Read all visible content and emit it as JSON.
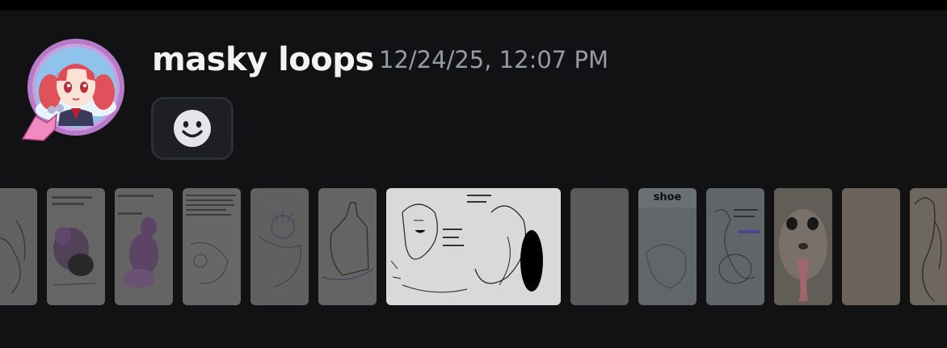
{
  "message": {
    "username": "masky loops",
    "timestamp": "12/24/25, 12:07 PM"
  },
  "reaction": {
    "icon": "smiley-face-icon",
    "label": "Add reaction"
  },
  "gallery": {
    "thumbnails": [
      {
        "name": "sketch-thumb-1",
        "active": false
      },
      {
        "name": "purple-character-thumb",
        "active": false
      },
      {
        "name": "purple-character-thumb-2",
        "active": false
      },
      {
        "name": "text-sketch-thumb",
        "active": false
      },
      {
        "name": "blue-sketch-thumb",
        "active": false
      },
      {
        "name": "bottle-sketch-thumb",
        "active": false
      },
      {
        "name": "selected-sketch-thumb",
        "active": true
      },
      {
        "name": "blank-thumb",
        "active": false
      },
      {
        "name": "shoe-thumb",
        "label": "shoe",
        "active": false
      },
      {
        "name": "sketch-thumb-blue-text",
        "active": false
      },
      {
        "name": "squirrel-photo-thumb",
        "active": false
      },
      {
        "name": "blank-beige-thumb",
        "active": false
      },
      {
        "name": "partial-sketch-thumb",
        "active": false
      }
    ]
  },
  "colors": {
    "background": "#121214",
    "username": "#f2f3f5",
    "timestamp": "#949ba4",
    "reaction_bg": "#1e1f22",
    "avatar_frame": "#a05ab4"
  }
}
